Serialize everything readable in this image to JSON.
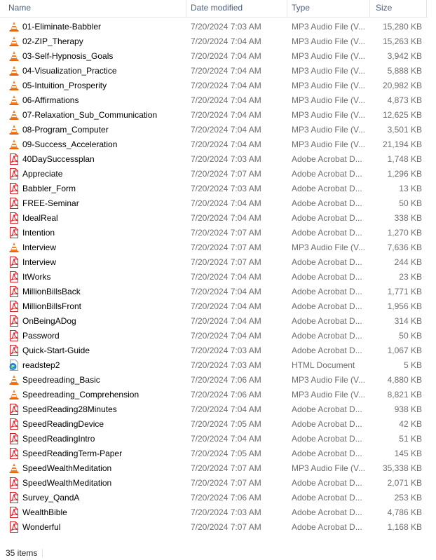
{
  "columns": {
    "name": "Name",
    "date": "Date modified",
    "type": "Type",
    "size": "Size"
  },
  "files": [
    {
      "name": "01-Eliminate-Babbler",
      "date": "7/20/2024 7:03 AM",
      "type": "MP3 Audio File (V...",
      "size": "15,280 KB",
      "icon": "vlc-cone-icon"
    },
    {
      "name": "02-ZIP_Therapy",
      "date": "7/20/2024 7:04 AM",
      "type": "MP3 Audio File (V...",
      "size": "15,263 KB",
      "icon": "vlc-cone-icon"
    },
    {
      "name": "03-Self-Hypnosis_Goals",
      "date": "7/20/2024 7:04 AM",
      "type": "MP3 Audio File (V...",
      "size": "3,942 KB",
      "icon": "vlc-cone-icon"
    },
    {
      "name": "04-Visualization_Practice",
      "date": "7/20/2024 7:04 AM",
      "type": "MP3 Audio File (V...",
      "size": "5,888 KB",
      "icon": "vlc-cone-icon"
    },
    {
      "name": "05-Intuition_Prosperity",
      "date": "7/20/2024 7:04 AM",
      "type": "MP3 Audio File (V...",
      "size": "20,982 KB",
      "icon": "vlc-cone-icon"
    },
    {
      "name": "06-Affirmations",
      "date": "7/20/2024 7:04 AM",
      "type": "MP3 Audio File (V...",
      "size": "4,873 KB",
      "icon": "vlc-cone-icon"
    },
    {
      "name": "07-Relaxation_Sub_Communication",
      "date": "7/20/2024 7:04 AM",
      "type": "MP3 Audio File (V...",
      "size": "12,625 KB",
      "icon": "vlc-cone-icon"
    },
    {
      "name": "08-Program_Computer",
      "date": "7/20/2024 7:04 AM",
      "type": "MP3 Audio File (V...",
      "size": "3,501 KB",
      "icon": "vlc-cone-icon"
    },
    {
      "name": "09-Success_Acceleration",
      "date": "7/20/2024 7:04 AM",
      "type": "MP3 Audio File (V...",
      "size": "21,194 KB",
      "icon": "vlc-cone-icon"
    },
    {
      "name": "40DaySuccessplan",
      "date": "7/20/2024 7:03 AM",
      "type": "Adobe Acrobat D...",
      "size": "1,748 KB",
      "icon": "pdf-icon"
    },
    {
      "name": "Appreciate",
      "date": "7/20/2024 7:07 AM",
      "type": "Adobe Acrobat D...",
      "size": "1,296 KB",
      "icon": "pdf-icon"
    },
    {
      "name": "Babbler_Form",
      "date": "7/20/2024 7:03 AM",
      "type": "Adobe Acrobat D...",
      "size": "13 KB",
      "icon": "pdf-icon"
    },
    {
      "name": "FREE-Seminar",
      "date": "7/20/2024 7:04 AM",
      "type": "Adobe Acrobat D...",
      "size": "50 KB",
      "icon": "pdf-icon"
    },
    {
      "name": "IdealReal",
      "date": "7/20/2024 7:04 AM",
      "type": "Adobe Acrobat D...",
      "size": "338 KB",
      "icon": "pdf-icon"
    },
    {
      "name": "Intention",
      "date": "7/20/2024 7:07 AM",
      "type": "Adobe Acrobat D...",
      "size": "1,270 KB",
      "icon": "pdf-icon"
    },
    {
      "name": "Interview",
      "date": "7/20/2024 7:07 AM",
      "type": "MP3 Audio File (V...",
      "size": "7,636 KB",
      "icon": "vlc-cone-icon"
    },
    {
      "name": "Interview",
      "date": "7/20/2024 7:07 AM",
      "type": "Adobe Acrobat D...",
      "size": "244 KB",
      "icon": "pdf-icon"
    },
    {
      "name": "ItWorks",
      "date": "7/20/2024 7:04 AM",
      "type": "Adobe Acrobat D...",
      "size": "23 KB",
      "icon": "pdf-icon"
    },
    {
      "name": "MillionBillsBack",
      "date": "7/20/2024 7:04 AM",
      "type": "Adobe Acrobat D...",
      "size": "1,771 KB",
      "icon": "pdf-icon"
    },
    {
      "name": "MillionBillsFront",
      "date": "7/20/2024 7:04 AM",
      "type": "Adobe Acrobat D...",
      "size": "1,956 KB",
      "icon": "pdf-icon"
    },
    {
      "name": "OnBeingADog",
      "date": "7/20/2024 7:04 AM",
      "type": "Adobe Acrobat D...",
      "size": "314 KB",
      "icon": "pdf-icon"
    },
    {
      "name": "Password",
      "date": "7/20/2024 7:04 AM",
      "type": "Adobe Acrobat D...",
      "size": "50 KB",
      "icon": "pdf-icon"
    },
    {
      "name": "Quick-Start-Guide",
      "date": "7/20/2024 7:03 AM",
      "type": "Adobe Acrobat D...",
      "size": "1,067 KB",
      "icon": "pdf-icon"
    },
    {
      "name": "readstep2",
      "date": "7/20/2024 7:03 AM",
      "type": "HTML Document",
      "size": "5 KB",
      "icon": "edge-html-icon"
    },
    {
      "name": "Speedreading_Basic",
      "date": "7/20/2024 7:06 AM",
      "type": "MP3 Audio File (V...",
      "size": "4,880 KB",
      "icon": "vlc-cone-icon"
    },
    {
      "name": "Speedreading_Comprehension",
      "date": "7/20/2024 7:06 AM",
      "type": "MP3 Audio File (V...",
      "size": "8,821 KB",
      "icon": "vlc-cone-icon"
    },
    {
      "name": "SpeedReading28Minutes",
      "date": "7/20/2024 7:04 AM",
      "type": "Adobe Acrobat D...",
      "size": "938 KB",
      "icon": "pdf-icon"
    },
    {
      "name": "SpeedReadingDevice",
      "date": "7/20/2024 7:05 AM",
      "type": "Adobe Acrobat D...",
      "size": "42 KB",
      "icon": "pdf-icon"
    },
    {
      "name": "SpeedReadingIntro",
      "date": "7/20/2024 7:04 AM",
      "type": "Adobe Acrobat D...",
      "size": "51 KB",
      "icon": "pdf-icon"
    },
    {
      "name": "SpeedReadingTerm-Paper",
      "date": "7/20/2024 7:05 AM",
      "type": "Adobe Acrobat D...",
      "size": "145 KB",
      "icon": "pdf-icon"
    },
    {
      "name": "SpeedWealthMeditation",
      "date": "7/20/2024 7:07 AM",
      "type": "MP3 Audio File (V...",
      "size": "35,338 KB",
      "icon": "vlc-cone-icon"
    },
    {
      "name": "SpeedWealthMeditation",
      "date": "7/20/2024 7:07 AM",
      "type": "Adobe Acrobat D...",
      "size": "2,071 KB",
      "icon": "pdf-icon"
    },
    {
      "name": "Survey_QandA",
      "date": "7/20/2024 7:06 AM",
      "type": "Adobe Acrobat D...",
      "size": "253 KB",
      "icon": "pdf-icon"
    },
    {
      "name": "WealthBible",
      "date": "7/20/2024 7:03 AM",
      "type": "Adobe Acrobat D...",
      "size": "4,786 KB",
      "icon": "pdf-icon"
    },
    {
      "name": "Wonderful",
      "date": "7/20/2024 7:07 AM",
      "type": "Adobe Acrobat D...",
      "size": "1,168 KB",
      "icon": "pdf-icon"
    }
  ],
  "status": {
    "item_count": "35 items"
  },
  "colors": {
    "header_text": "#4c607a",
    "detail_text": "#6d6d6d",
    "vlc_orange": "#f47b20",
    "pdf_red": "#d8222a",
    "edge_blue": "#1f7fd3"
  }
}
